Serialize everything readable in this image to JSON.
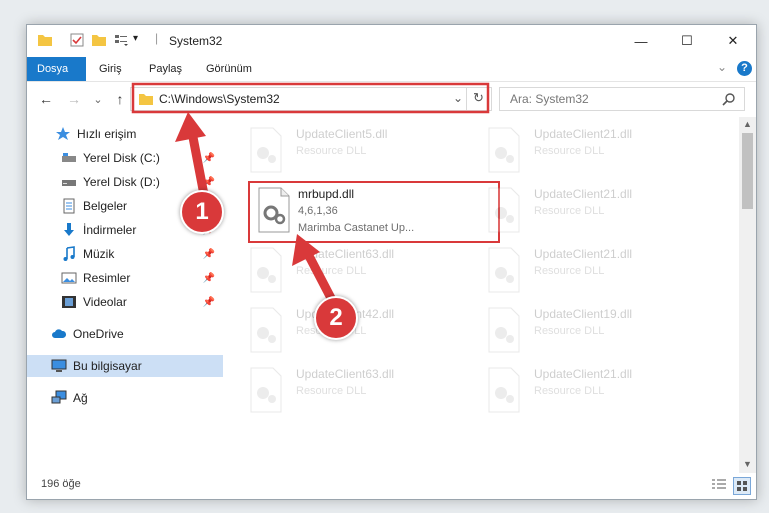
{
  "window": {
    "title": "System32",
    "minimize": "—",
    "maximize": "☐",
    "close": "✕"
  },
  "ribbon": {
    "tabs": [
      "Dosya",
      "Giriş",
      "Paylaş",
      "Görünüm"
    ],
    "collapse": "⌄",
    "help": "?"
  },
  "nav": {
    "back": "←",
    "forward": "→",
    "recent": "⌄",
    "up": "↑",
    "address": "C:\\Windows\\System32",
    "address_dropdown": "⌄",
    "refresh": "↻",
    "search_placeholder": "Ara: System32"
  },
  "sidebar": {
    "items": [
      {
        "label": "Hızlı erişim",
        "icon": "star-icon"
      },
      {
        "label": "Yerel Disk (C:)",
        "icon": "drive-icon",
        "pinned": true
      },
      {
        "label": "Yerel Disk (D:)",
        "icon": "drive-icon",
        "pinned": true
      },
      {
        "label": "Belgeler",
        "icon": "documents-icon",
        "pinned": true
      },
      {
        "label": "İndirmeler",
        "icon": "download-icon",
        "pinned": true
      },
      {
        "label": "Müzik",
        "icon": "music-icon",
        "pinned": true
      },
      {
        "label": "Resimler",
        "icon": "pictures-icon",
        "pinned": true
      },
      {
        "label": "Videolar",
        "icon": "videos-icon",
        "pinned": true
      },
      {
        "label": "OneDrive",
        "icon": "cloud-icon"
      },
      {
        "label": "Bu bilgisayar",
        "icon": "computer-icon",
        "selected": true
      },
      {
        "label": "Ağ",
        "icon": "network-icon"
      }
    ]
  },
  "files": {
    "highlighted": {
      "name": "mrbupd.dll",
      "version": "4,6,1,36",
      "description": "Marimba Castanet Up..."
    },
    "faded": [
      {
        "name": "UpdateClient5.dll",
        "desc": "Resource DLL"
      },
      {
        "name": "UpdateClient21.dll",
        "desc": "Resource DLL"
      },
      {
        "name": "UpdateClient21.dll",
        "desc": "Resource DLL"
      },
      {
        "name": "UpdateClient63.dll",
        "desc": "Resource DLL"
      },
      {
        "name": "UpdateClient21.dll",
        "desc": "Resource DLL"
      },
      {
        "name": "UpdateClient42.dll",
        "desc": "Resource DLL"
      },
      {
        "name": "UpdateClient19.dll",
        "desc": "Resource DLL"
      },
      {
        "name": "UpdateClient63.dll",
        "desc": "Resource DLL"
      },
      {
        "name": "UpdateClient21.dll",
        "desc": "Resource DLL"
      }
    ]
  },
  "status": {
    "count": "196 öğe"
  },
  "annotations": {
    "step1": "1",
    "step2": "2",
    "color": "#d9393a"
  }
}
